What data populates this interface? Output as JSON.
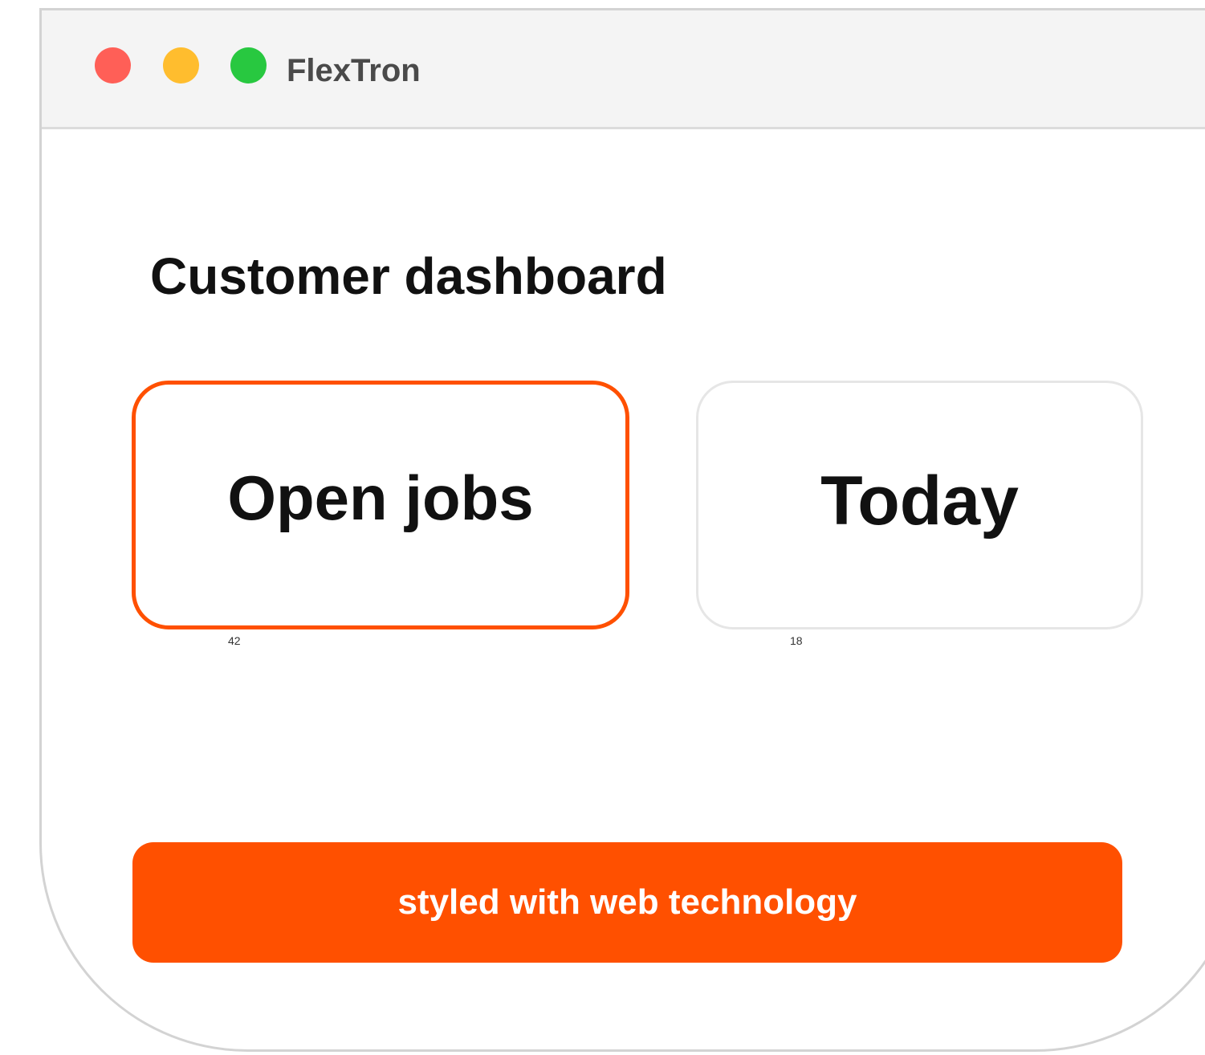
{
  "window": {
    "title": "FlexTron",
    "controls": {
      "close": {
        "icon": "close-dot-icon",
        "color": "#ff5f57"
      },
      "minimize": {
        "icon": "minimize-dot-icon",
        "color": "#ffbd2e"
      },
      "maximize": {
        "icon": "maximize-dot-icon",
        "color": "#28c840"
      }
    }
  },
  "main": {
    "title": "Customer dashboard",
    "cards": [
      {
        "label": "Open jobs",
        "value": "42",
        "selected": true
      },
      {
        "label": "Today",
        "value": "18",
        "selected": false
      }
    ],
    "cta": {
      "label": "styled with web technology"
    }
  },
  "colors": {
    "accent": "#ff5000",
    "title_text": "#111111",
    "titlebar_bg": "#f4f4f4",
    "window_border": "#d3d3d3"
  }
}
